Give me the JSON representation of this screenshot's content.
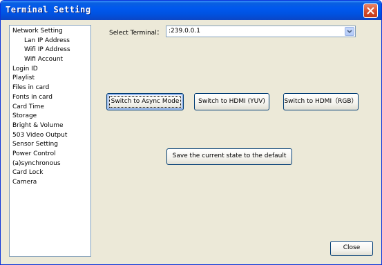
{
  "window": {
    "title": "Terminal Setting"
  },
  "nav": {
    "items": [
      {
        "label": "Network Setting",
        "level": 0
      },
      {
        "label": "Lan IP Address",
        "level": 1
      },
      {
        "label": "Wifi IP Address",
        "level": 1
      },
      {
        "label": "Wifi Account",
        "level": 1
      },
      {
        "label": "Login ID",
        "level": 0
      },
      {
        "label": "Playlist",
        "level": 0
      },
      {
        "label": "Files in card",
        "level": 0
      },
      {
        "label": "Fonts in card",
        "level": 0
      },
      {
        "label": "Card Time",
        "level": 0
      },
      {
        "label": "Storage",
        "level": 0
      },
      {
        "label": "Bright & Volume",
        "level": 0
      },
      {
        "label": "503 Video Output",
        "level": 0
      },
      {
        "label": "Sensor Setting",
        "level": 0
      },
      {
        "label": "Power Control",
        "level": 0
      },
      {
        "label": "(a)synchronous",
        "level": 0
      },
      {
        "label": "Card Lock",
        "level": 0
      },
      {
        "label": "Camera",
        "level": 0
      }
    ]
  },
  "terminal": {
    "label": "Select Terminal：",
    "value": ":239.0.0.1"
  },
  "buttons": {
    "async": "Switch to Async Mode",
    "hdmi_yuv": "Switch to HDMI (YUV)",
    "hdmi_rgb": "Switch to HDMI（RGB）",
    "save_default": "Save the current state to the default",
    "close": "Close"
  },
  "icons": {
    "close": "close-icon",
    "dropdown": "chevron-down-icon"
  },
  "colors": {
    "titlebar": "#0058ee",
    "close_button": "#d54d2b",
    "window_bg": "#ece9d8",
    "button_border": "#003c74"
  }
}
